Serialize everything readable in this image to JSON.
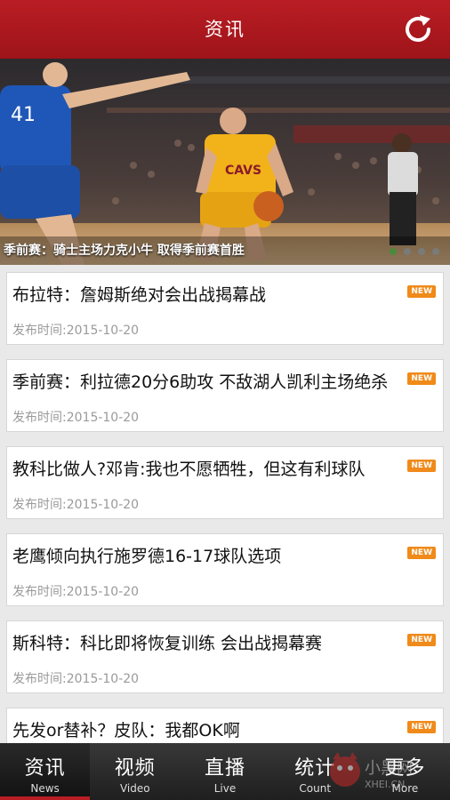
{
  "header": {
    "title": "资讯",
    "refresh_icon": "refresh-icon"
  },
  "hero": {
    "caption": "季前赛：骑士主场力克小牛 取得季前赛首胜",
    "slide_count": 4,
    "active_slide": 1
  },
  "news": [
    {
      "title": "布拉特：詹姆斯绝对会出战揭幕战",
      "meta": "发布时间:2015-10-20",
      "badge": "NEW"
    },
    {
      "title": "季前赛：利拉德20分6助攻 不敌湖人凯利主场绝杀",
      "meta": "发布时间:2015-10-20",
      "badge": "NEW"
    },
    {
      "title": "教科比做人?邓肯:我也不愿牺牲，但这有利球队",
      "meta": "发布时间:2015-10-20",
      "badge": "NEW"
    },
    {
      "title": "老鹰倾向执行施罗德16-17球队选项",
      "meta": "发布时间:2015-10-20",
      "badge": "NEW"
    },
    {
      "title": "斯科特：科比即将恢复训练 会出战揭幕赛",
      "meta": "发布时间:2015-10-20",
      "badge": "NEW"
    },
    {
      "title": "先发or替补？皮队：我都OK啊",
      "meta": "",
      "badge": "NEW"
    }
  ],
  "tabs": [
    {
      "cn": "资讯",
      "en": "News"
    },
    {
      "cn": "视频",
      "en": "Video"
    },
    {
      "cn": "直播",
      "en": "Live"
    },
    {
      "cn": "统计",
      "en": "Count"
    },
    {
      "cn": "更多",
      "en": "More"
    }
  ],
  "watermark": {
    "cn": "小黑网",
    "en": "XHEI.CN"
  },
  "colors": {
    "brand_red": "#b91d24",
    "badge_orange": "#f08a1a",
    "tabbar_dark": "#2a2a2a"
  }
}
